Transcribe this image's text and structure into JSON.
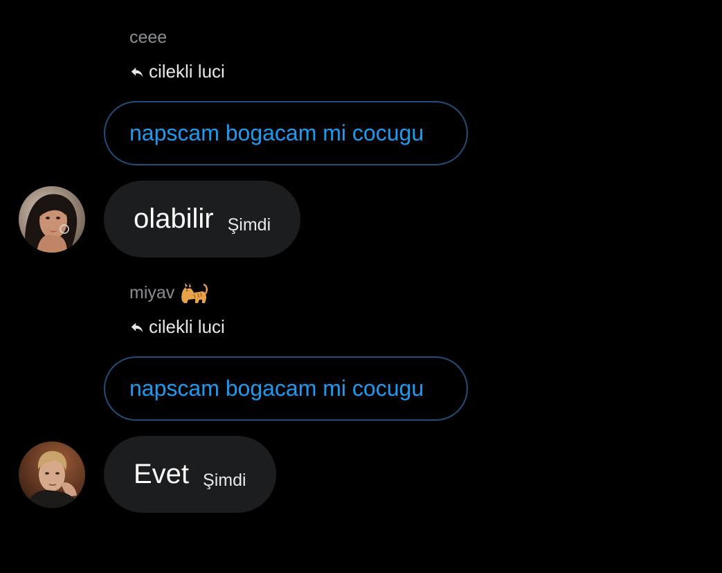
{
  "conversation": {
    "accent_color": "#1d9bf0",
    "messages": [
      {
        "sender_name": "ceee",
        "reply_icon": "reply-arrow-icon",
        "reply_to": "cilekli luci",
        "quoted_text": "napscam bogacam mi cocugu",
        "message_text": "olabilir",
        "timestamp": "Şimdi",
        "avatar": "woman-with-dark-hair-avatar"
      },
      {
        "sender_name": "miyav",
        "sender_emoji": "cat-emoji",
        "reply_icon": "reply-arrow-icon",
        "reply_to": "cilekli luci",
        "quoted_text": "napscam bogacam mi cocugu",
        "message_text": "Evet",
        "timestamp": "Şimdi",
        "avatar": "man-with-blond-hair-avatar"
      }
    ]
  }
}
